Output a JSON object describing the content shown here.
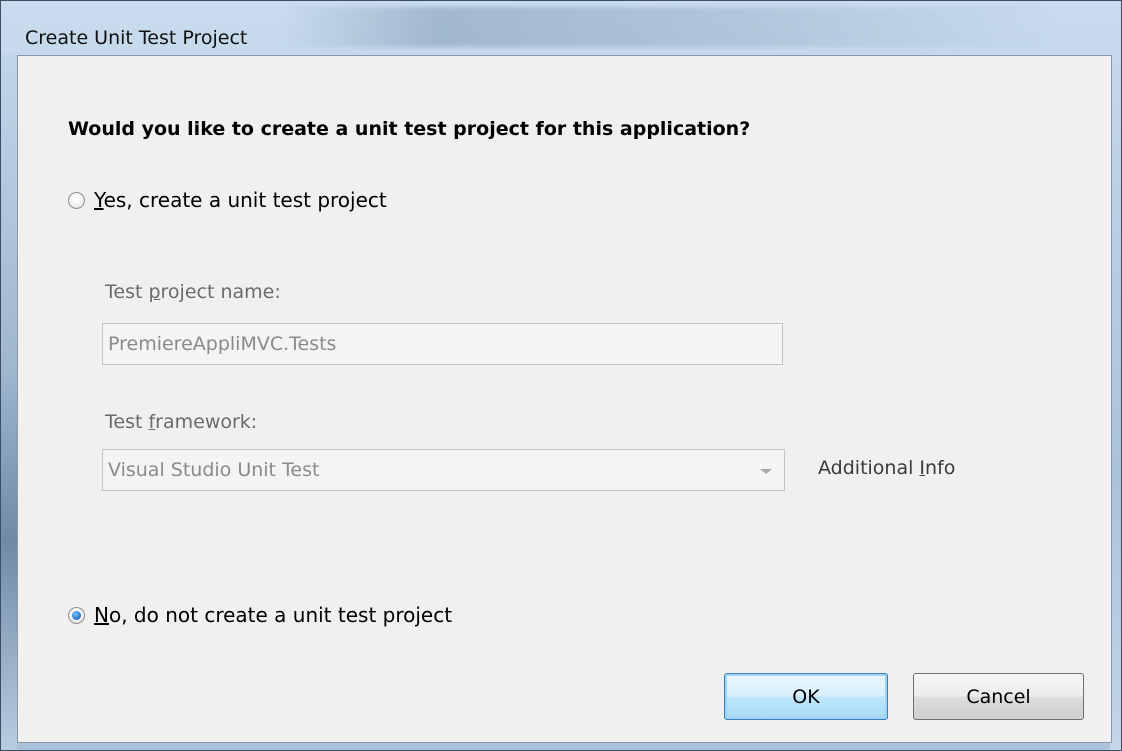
{
  "window": {
    "title": "Create Unit Test Project"
  },
  "dialog": {
    "question": "Would you like to create a unit test project for this application?",
    "yes_option": {
      "accel": "Y",
      "rest": "es, create a unit test project",
      "checked": false
    },
    "test_project_name": {
      "label_pre": "Test ",
      "label_accel": "p",
      "label_post": "roject name:",
      "value": "PremiereAppliMVC.Tests",
      "enabled": false
    },
    "test_framework": {
      "label_pre": "Test ",
      "label_accel": "f",
      "label_post": "ramework:",
      "selected": "Visual Studio Unit Test",
      "enabled": false
    },
    "additional_info": {
      "pre": "Additional ",
      "accel": "I",
      "post": "nfo"
    },
    "no_option": {
      "accel": "N",
      "rest": "o, do not create a unit test project",
      "checked": true
    },
    "buttons": {
      "ok": "OK",
      "cancel": "Cancel"
    }
  },
  "colors": {
    "accent": "#3c7fb1",
    "radio_selected": "#2c7fd6",
    "disabled_text": "#8a8a8a"
  }
}
